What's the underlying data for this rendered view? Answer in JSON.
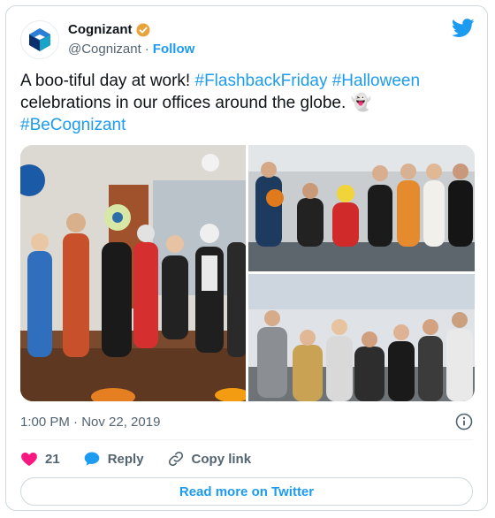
{
  "author": {
    "name": "Cognizant",
    "handle": "@Cognizant",
    "follow_label": "Follow",
    "verified": true,
    "badge_color": "#e8a33d"
  },
  "tweet": {
    "line1_text": "A boo-tiful day at work! ",
    "hashtag1": "#FlashbackFriday",
    "hashtag2": "#Halloween",
    "line2_text": "celebrations in our offices around the globe. ",
    "emoji": "👻",
    "hashtag3": "#BeCognizant"
  },
  "media": {
    "photos": [
      {
        "description_icon": "photo-icon"
      },
      {
        "description_icon": "photo-icon"
      },
      {
        "description_icon": "photo-icon"
      }
    ]
  },
  "meta": {
    "timestamp": "1:00 PM · Nov 22, 2019"
  },
  "actions": {
    "like_count": "21",
    "reply_label": "Reply",
    "copy_link_label": "Copy link"
  },
  "footer": {
    "read_more_label": "Read more on Twitter"
  },
  "colors": {
    "accent": "#1d9bf0",
    "like": "#f91880",
    "muted": "#536471",
    "border": "#cfd9de"
  }
}
